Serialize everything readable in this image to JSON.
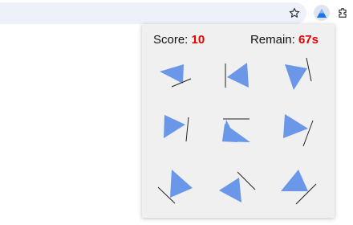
{
  "hud": {
    "score_label": "Score:",
    "score_value": "10",
    "remain_label": "Remain:",
    "remain_value": "67s"
  },
  "colors": {
    "shape_fill": "#6b97e8",
    "value_text": "#e60000",
    "line": "#222222"
  },
  "icons": {
    "star": "star-icon",
    "extension": "triangle-extension-icon",
    "extensions_menu": "puzzle-icon"
  }
}
